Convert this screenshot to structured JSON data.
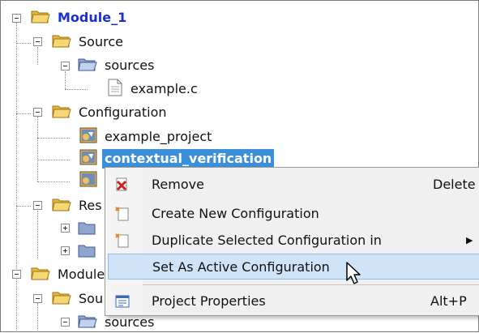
{
  "tree": {
    "module1": "Module_1",
    "source": "Source",
    "sources": "sources",
    "example_c": "example.c",
    "configuration": "Configuration",
    "example_project": "example_project",
    "contextual_verification": "contextual_verification",
    "resources_partial": "Res",
    "module2_partial": "Module",
    "source2_partial": "Sou",
    "sources2": "sources"
  },
  "context_menu": {
    "items": [
      {
        "label": "Remove",
        "shortcut": "Delete",
        "icon": "red-x-remove-icon"
      },
      {
        "label": "Create New Configuration",
        "shortcut": "",
        "icon": "new-config-icon"
      },
      {
        "label": "Duplicate Selected Configuration in",
        "shortcut": "",
        "icon": "duplicate-config-icon",
        "submenu_arrow": "▶"
      },
      {
        "label": "Set As Active Configuration",
        "shortcut": "",
        "icon": ""
      },
      {
        "label": "Project Properties",
        "shortcut": "Alt+P",
        "icon": "properties-window-icon"
      }
    ],
    "hovered_item": "Set As Active Configuration"
  },
  "colors": {
    "selection": "#3a8fd8",
    "module_text": "#1a2fd6",
    "hover": "#cfe4f9",
    "folder": "#f0c14b"
  }
}
